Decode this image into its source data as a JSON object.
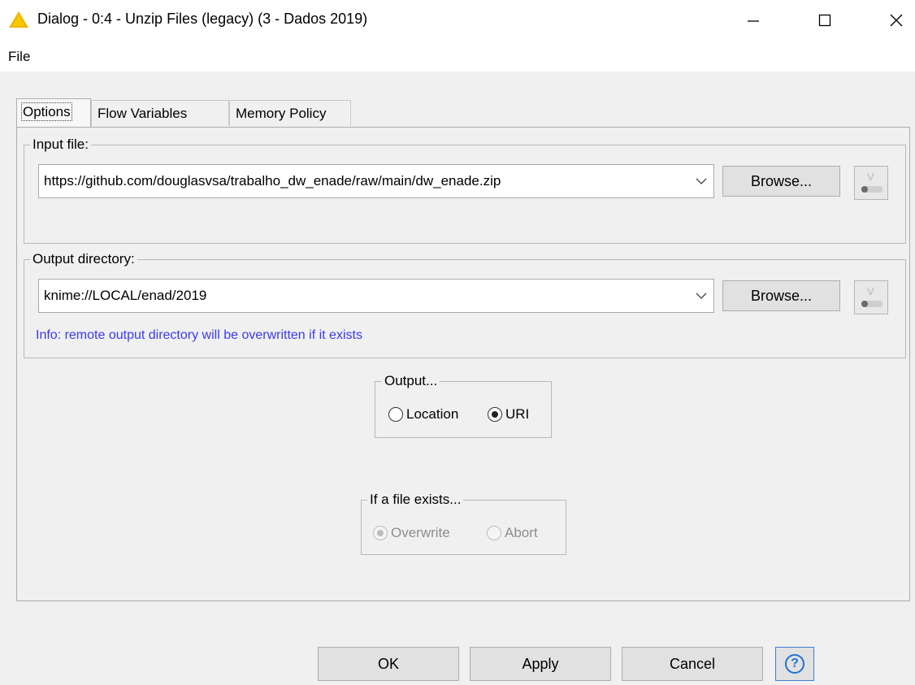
{
  "window": {
    "title": "Dialog - 0:4 - Unzip Files (legacy) (3 - Dados 2019)",
    "icon": "warning-triangle-icon",
    "controls": {
      "minimize": "minimize-icon",
      "maximize": "maximize-icon",
      "close": "close-icon"
    }
  },
  "menu": {
    "file": "File"
  },
  "tabs": [
    {
      "label": "Options",
      "active": true
    },
    {
      "label": "Flow Variables",
      "active": false
    },
    {
      "label": "Memory Policy",
      "active": false
    }
  ],
  "input_file": {
    "legend": "Input file:",
    "value": "https://github.com/douglasvsa/trabalho_dw_enade/raw/main/dw_enade.zip",
    "browse_label": "Browse...",
    "flow_var_icon": "flow-variable-icon"
  },
  "output_directory": {
    "legend": "Output directory:",
    "value": "knime://LOCAL/enad/2019",
    "browse_label": "Browse...",
    "info": "Info: remote output directory will be overwritten if it exists",
    "flow_var_icon": "flow-variable-icon"
  },
  "output": {
    "legend": "Output...",
    "options": [
      {
        "label": "Location",
        "checked": false
      },
      {
        "label": "URI",
        "checked": true
      }
    ]
  },
  "if_exists": {
    "legend": "If a file exists...",
    "enabled": false,
    "options": [
      {
        "label": "Overwrite",
        "checked": true
      },
      {
        "label": "Abort",
        "checked": false
      }
    ]
  },
  "footer": {
    "ok": "OK",
    "apply": "Apply",
    "cancel": "Cancel",
    "help_icon": "help-icon"
  },
  "colors": {
    "info_text": "#3a3af0",
    "warning_icon": "#f0b400",
    "help_icon": "#1e73d8"
  }
}
